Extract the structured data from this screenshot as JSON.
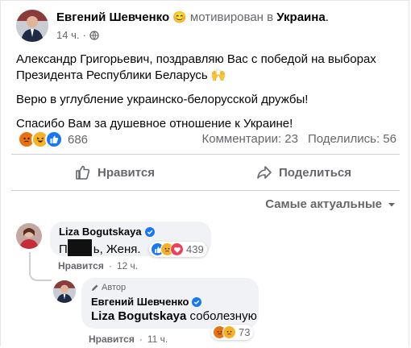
{
  "post": {
    "author": "Евгений Шевченко",
    "feeling_emoji": "😊",
    "feeling_text": "мотивирован в",
    "place": "Украина",
    "place_suffix": ".",
    "time": "14 ч.",
    "line1a": "Александр Григорьевич, поздравляю Вас с победой на  выборах",
    "line1b": "Президента Республики Беларусь 🙌",
    "line2": "Верю в углубление украинско-белорусской дружбы!",
    "line3": "Спасибо Вам за душевное отношение к Украине!",
    "reactions_count": "686",
    "comments_text": "Комментарии: 23",
    "shares_text": "Поделились: 56"
  },
  "actions": {
    "like": "Нравится",
    "share": "Поделиться"
  },
  "sort": {
    "label": "Самые актуальные"
  },
  "comments": [
    {
      "author": "Liza Bogutskaya",
      "text_before": "П",
      "text_after": "ь, Женя.",
      "reaction_count": "439",
      "like_label": "Нравится",
      "time": "12 ч."
    }
  ],
  "reply": {
    "badge": "Автор",
    "author": "Евгений Шевченко",
    "mention": "Liza Bogutskaya",
    "text": "соболезную",
    "reaction_count": "73",
    "like_label": "Нравится",
    "time": "11 ч."
  },
  "colors": {
    "brand": "#1877f2",
    "muted": "#65676b",
    "bubble": "#f0f2f5"
  }
}
